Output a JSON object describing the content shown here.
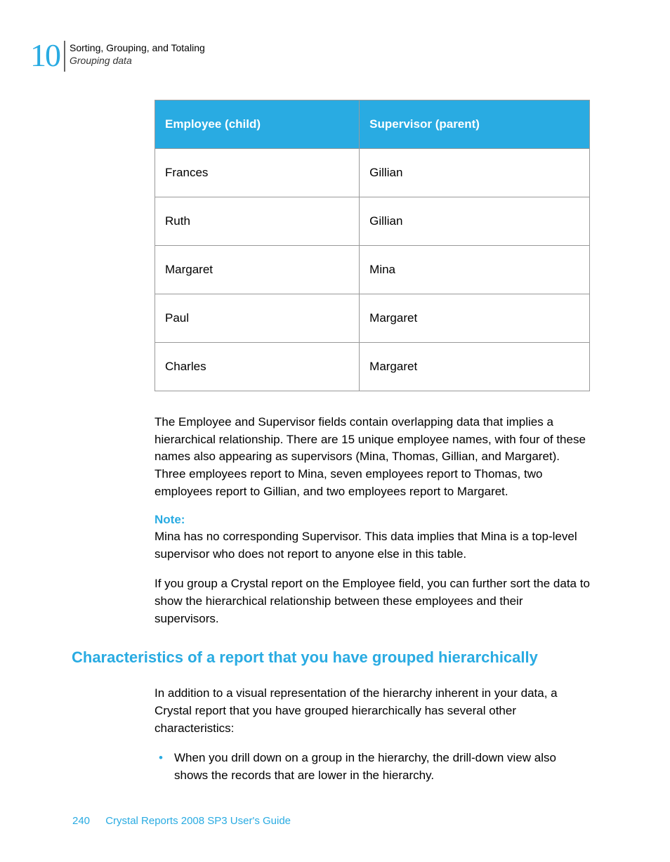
{
  "header": {
    "chapterNumber": "10",
    "chapterTitle": "Sorting, Grouping, and Totaling",
    "sectionTitle": "Grouping data"
  },
  "table": {
    "headers": {
      "col1": "Employee (child)",
      "col2": "Supervisor (parent)"
    },
    "rows": [
      {
        "employee": "Frances",
        "supervisor": "Gillian"
      },
      {
        "employee": "Ruth",
        "supervisor": "Gillian"
      },
      {
        "employee": "Margaret",
        "supervisor": "Mina"
      },
      {
        "employee": "Paul",
        "supervisor": "Margaret"
      },
      {
        "employee": "Charles",
        "supervisor": "Margaret"
      }
    ]
  },
  "paragraphs": {
    "p1": "The Employee and Supervisor fields contain overlapping data that implies a hierarchical relationship. There are 15 unique employee names, with four of these names also appearing as supervisors (Mina, Thomas, Gillian, and Margaret). Three employees report to Mina, seven employees report to Thomas, two employees report to Gillian, and two employees report to Margaret.",
    "noteLabel": "Note:",
    "noteText": "Mina has no corresponding Supervisor. This data implies that Mina is a top-level supervisor who does not report to anyone else in this table.",
    "p2": "If you group a Crystal report on the Employee field, you can further sort the data to show the hierarchical relationship between these employees and their supervisors.",
    "heading": "Characteristics of a report that you have grouped hierarchically",
    "p3": "In addition to a visual representation of the hierarchy inherent in your data, a Crystal report that you have grouped hierarchically has several other characteristics:",
    "bullet1": "When you drill down on a group in the hierarchy, the drill-down view also shows the records that are lower in the hierarchy."
  },
  "footer": {
    "pageNumber": "240",
    "title": "Crystal Reports 2008 SP3 User's Guide"
  }
}
